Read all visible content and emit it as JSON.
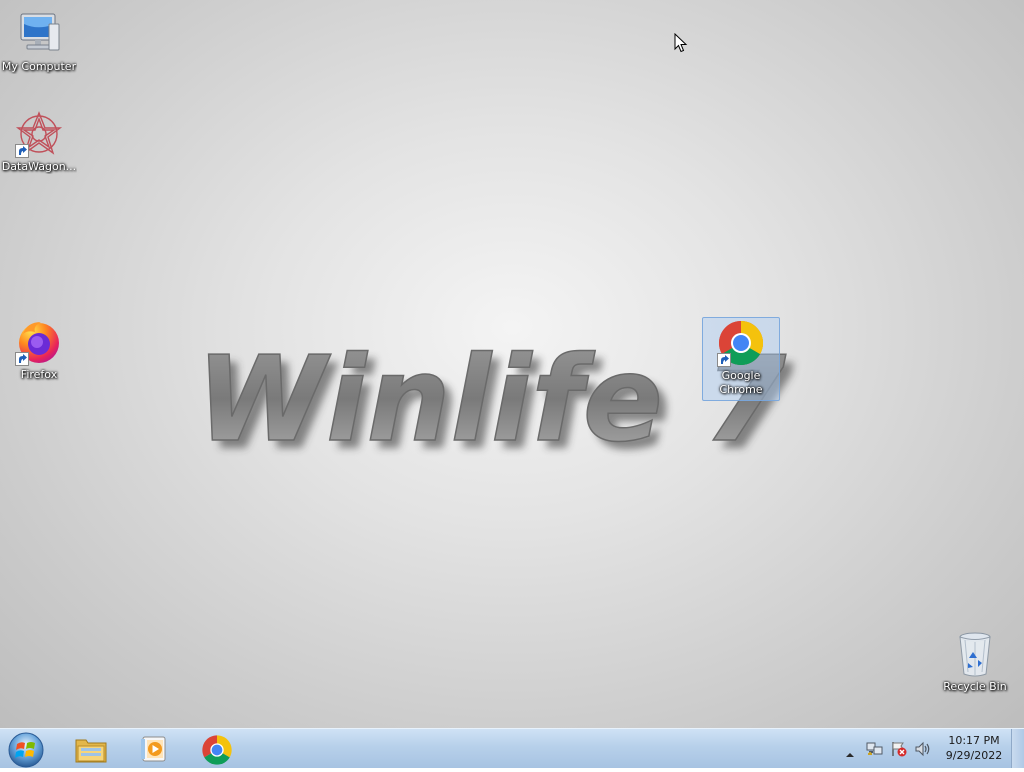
{
  "desktop": {
    "icons": [
      {
        "label": "My Computer",
        "icon": "computer-icon"
      },
      {
        "label": "DataWagon...",
        "icon": "datawagon-icon"
      },
      {
        "label": "Firefox",
        "icon": "firefox-icon"
      },
      {
        "label": "Google Chrome",
        "icon": "chrome-icon",
        "selected": true
      },
      {
        "label": "Recycle Bin",
        "icon": "recycle-bin-icon"
      }
    ],
    "wallpaper_text": "Winlife 7"
  },
  "taskbar": {
    "start": {
      "icon": "windows-start-orb-icon"
    },
    "pinned": [
      {
        "icon": "windows-explorer-icon"
      },
      {
        "icon": "media-player-icon"
      },
      {
        "icon": "chrome-icon"
      }
    ],
    "tray": {
      "icons": [
        "show-hidden-icons-chevron",
        "network-icon",
        "action-center-flag-icon",
        "volume-icon"
      ]
    },
    "clock": {
      "time": "10:17 PM",
      "date": "9/29/2022"
    }
  },
  "colors": {
    "taskbar": "#b7d0ea",
    "desktop_center": "#f4f4f4",
    "desktop_edge": "#bdbdbd",
    "selection": "#aacdf5"
  }
}
